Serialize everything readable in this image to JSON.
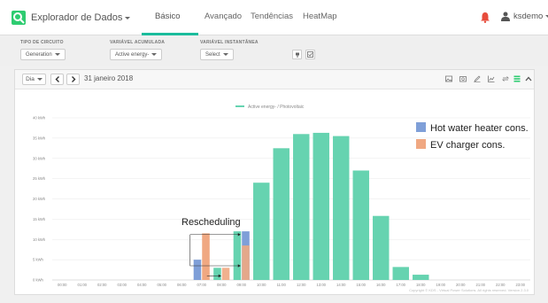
{
  "navbar": {
    "brand": "Explorador de Dados",
    "tabs": [
      "Básico",
      "Avançado",
      "Tendências",
      "HeatMap"
    ],
    "active_tab": "Básico",
    "user": "ksdemo",
    "accent_color": "#1abc9c",
    "alert_color": "#e74c3c"
  },
  "filters": {
    "circuit_type_label": "TIPO DE CIRCUITO",
    "circuit_type_value": "Generation",
    "accumulated_label": "VARIÁVEL ACUMULADA",
    "accumulated_value": "Active energy-",
    "instant_label": "VARIÁVEL INSTANTÂNEA",
    "instant_value": "Select"
  },
  "toolbar": {
    "period": "Dia",
    "date": "31 janeiro 2018",
    "icons": [
      "image-icon",
      "camera-icon",
      "pen-icon",
      "line-chart-icon",
      "refresh-icon",
      "bars-icon",
      "chevron-up-icon"
    ]
  },
  "chart_data": {
    "type": "bar",
    "legend_series": "Active energy- / Photovoltaic",
    "categories": [
      "00:00",
      "01:00",
      "02:00",
      "03:00",
      "04:00",
      "05:00",
      "06:00",
      "07:00",
      "08:00",
      "09:00",
      "10:00",
      "11:00",
      "12:00",
      "13:00",
      "14:00",
      "15:00",
      "16:00",
      "17:00",
      "18:00",
      "19:00",
      "20:00",
      "21:00",
      "22:00",
      "23:00"
    ],
    "ylabels": [
      "0 kWh",
      "5 kWh",
      "10 kWh",
      "15 kWh",
      "20 kWh",
      "25 kWh",
      "30 kWh",
      "35 kWh",
      "40 kWh"
    ],
    "ylim": [
      0,
      40
    ],
    "series": [
      {
        "name": "Active energy- / Photovoltaic",
        "color": "#66d3b0",
        "values": [
          0,
          0,
          0,
          0,
          0,
          0,
          0,
          0,
          3,
          12,
          24,
          32.5,
          36,
          36.3,
          35.5,
          27,
          15.8,
          3.2,
          1.3,
          0,
          0,
          0,
          0,
          0
        ]
      },
      {
        "name": "Hot water heater cons.",
        "color": "#7f9fd8",
        "values": [
          0,
          0,
          0,
          0,
          0,
          0,
          0,
          5,
          0,
          12,
          0,
          0,
          0,
          0,
          0,
          0,
          0,
          0,
          0,
          0,
          0,
          0,
          0,
          0
        ]
      },
      {
        "name": "EV charger cons.",
        "color": "#f0a882",
        "values": [
          0,
          0,
          0,
          0,
          0,
          0,
          0,
          11.5,
          3,
          8.5,
          0,
          0,
          0,
          0,
          0,
          0,
          0,
          0,
          0,
          0,
          0,
          0,
          0,
          0
        ]
      }
    ],
    "annotation": "Rescheduling",
    "overlay_legend": [
      {
        "label": "Hot water heater cons.",
        "color": "#7f9fd8"
      },
      {
        "label": "EV charger cons.",
        "color": "#f0a882"
      }
    ]
  },
  "footer": "Copyright © KDS - Virtual Power Solutions. All rights reserved. Version 2.3.0"
}
